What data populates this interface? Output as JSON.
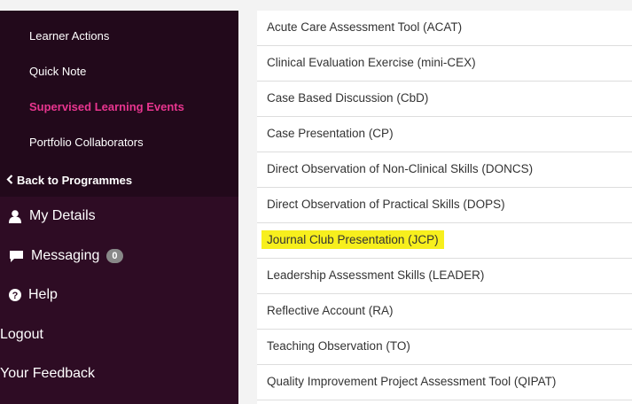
{
  "sidebar": {
    "submenu": [
      {
        "label": "Learner Actions"
      },
      {
        "label": "Quick Note"
      },
      {
        "label": "Supervised Learning Events"
      },
      {
        "label": "Portfolio Collaborators"
      }
    ],
    "back_label": "Back to Programmes",
    "main": [
      {
        "label": "My Details"
      },
      {
        "label": "Messaging",
        "badge": "0"
      },
      {
        "label": "Help"
      },
      {
        "label": "Logout"
      },
      {
        "label": "Your Feedback"
      }
    ]
  },
  "events": [
    {
      "label": "Acute Care Assessment Tool (ACAT)"
    },
    {
      "label": "Clinical Evaluation Exercise (mini-CEX)"
    },
    {
      "label": "Case Based Discussion (CbD)"
    },
    {
      "label": "Case Presentation (CP)"
    },
    {
      "label": "Direct Observation of Non-Clinical Skills (DONCS)"
    },
    {
      "label": "Direct Observation of Practical Skills (DOPS)"
    },
    {
      "label": "Journal Club Presentation (JCP)"
    },
    {
      "label": "Leadership Assessment Skills (LEADER)"
    },
    {
      "label": "Reflective Account (RA)"
    },
    {
      "label": "Teaching Observation (TO)"
    },
    {
      "label": "Quality Improvement Project Assessment Tool (QIPAT)"
    }
  ],
  "colors": {
    "sidebar_bg": "#2e0c24",
    "submenu_bg": "#22091b",
    "active_accent": "#e8358f",
    "highlight": "#f7ef1d"
  },
  "icons": {
    "back": "chevron-left-icon",
    "my_details": "user-icon",
    "messaging": "speech-bubble-icon",
    "help": "question-circle-icon"
  }
}
